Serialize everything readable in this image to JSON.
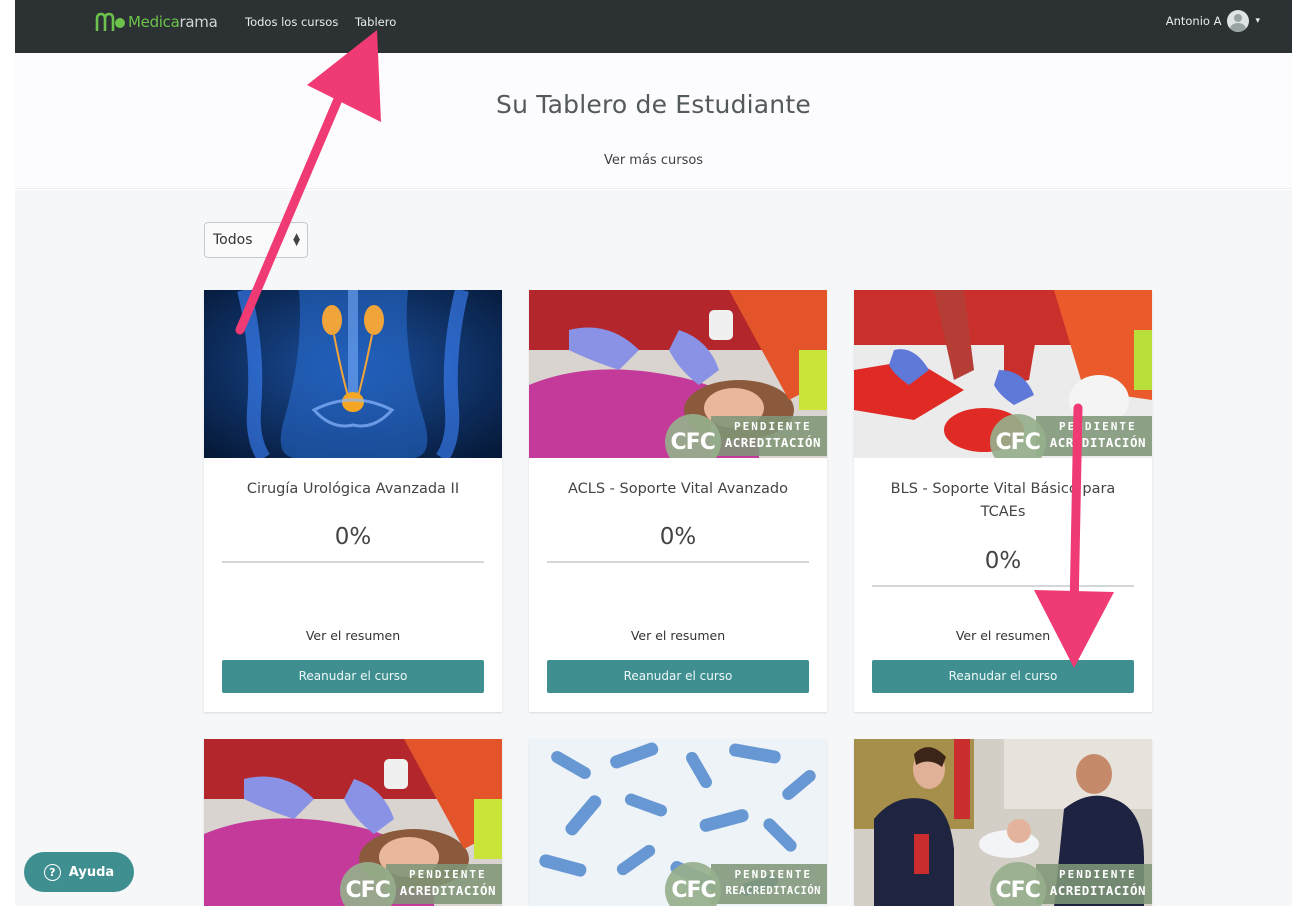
{
  "nav": {
    "brand_medica": "Medica",
    "brand_rama": "rama",
    "links": [
      "Todos los cursos",
      "Tablero"
    ],
    "user_name": "Antonio A",
    "caret": "▾"
  },
  "hero": {
    "title": "Su Tablero de Estudiante",
    "more_link": "Ver más cursos"
  },
  "filter": {
    "selected": "Todos",
    "arrows": "▲▼"
  },
  "cards": [
    {
      "title": "Cirugía Urológica Avanzada II",
      "progress_text": "0%",
      "progress": 0,
      "summary": "Ver el resumen",
      "button": "Reanudar el curso",
      "badge": null
    },
    {
      "title": "ACLS - Soporte Vital Avanzado",
      "progress_text": "0%",
      "progress": 0,
      "summary": "Ver el resumen",
      "button": "Reanudar el curso",
      "badge": {
        "logo": "CFC",
        "line1": "PENDIENTE",
        "line2": "ACREDITACIÓN"
      }
    },
    {
      "title": "BLS - Soporte Vital Básico para TCAEs",
      "progress_text": "0%",
      "progress": 0,
      "summary": "Ver el resumen",
      "button": "Reanudar el curso",
      "badge": {
        "logo": "CFC",
        "line1": "PENDIENTE",
        "line2": "ACREDITACIÓN"
      }
    },
    {
      "badge": {
        "logo": "CFC",
        "line1": "PENDIENTE",
        "line2": "ACREDITACIÓN"
      }
    },
    {
      "badge": {
        "logo": "CFC",
        "line1": "PENDIENTE",
        "line2": "REACREDITACIÓN"
      }
    },
    {
      "badge": {
        "logo": "CFC",
        "line1": "PENDIENTE",
        "line2": "ACREDITACIÓN"
      }
    }
  ],
  "help": {
    "label": "Ayuda",
    "icon": "?"
  },
  "colors": {
    "accent": "#3f8f90",
    "navbar": "#2c3234",
    "brand_green": "#6cc24a",
    "annotation_arrow": "#f03a73"
  }
}
